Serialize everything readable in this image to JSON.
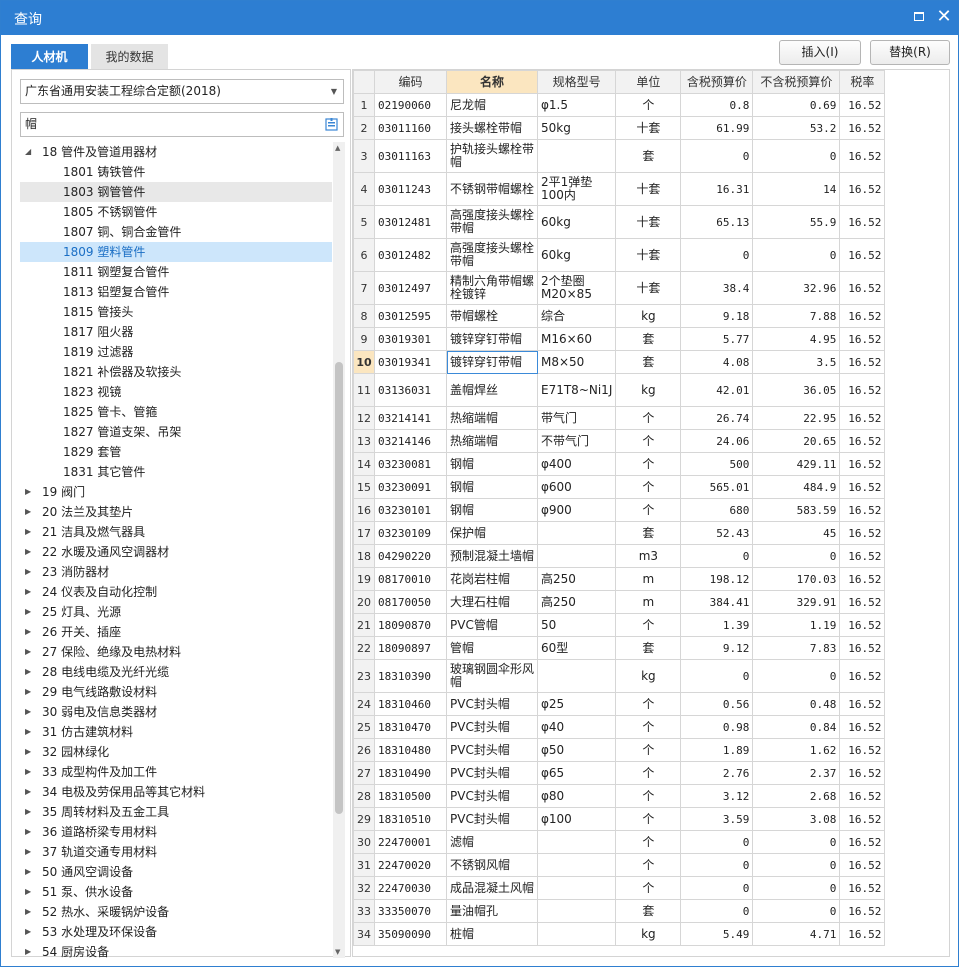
{
  "window": {
    "title": "查询"
  },
  "tabs": [
    {
      "label": "人材机"
    },
    {
      "label": "我的数据"
    }
  ],
  "toolbar": {
    "insert_label": "插入(I)",
    "replace_label": "替换(R)"
  },
  "left": {
    "quota_select": "广东省通用安装工程综合定额(2018)",
    "search_value": "帽",
    "tree": [
      {
        "label": "18 管件及管道用器材",
        "level": 0,
        "expanded": true
      },
      {
        "label": "1801 铸铁管件",
        "level": 1
      },
      {
        "label": "1803 钢管管件",
        "level": 1,
        "hover": true
      },
      {
        "label": "1805 不锈钢管件",
        "level": 1
      },
      {
        "label": "1807 铜、铜合金管件",
        "level": 1
      },
      {
        "label": "1809 塑料管件",
        "level": 1,
        "selected": true
      },
      {
        "label": "1811 钢塑复合管件",
        "level": 1
      },
      {
        "label": "1813 铝塑复合管件",
        "level": 1
      },
      {
        "label": "1815 管接头",
        "level": 1
      },
      {
        "label": "1817 阻火器",
        "level": 1
      },
      {
        "label": "1819 过滤器",
        "level": 1
      },
      {
        "label": "1821 补偿器及软接头",
        "level": 1
      },
      {
        "label": "1823 视镜",
        "level": 1
      },
      {
        "label": "1825 管卡、管箍",
        "level": 1
      },
      {
        "label": "1827 管道支架、吊架",
        "level": 1
      },
      {
        "label": "1829 套管",
        "level": 1
      },
      {
        "label": "1831 其它管件",
        "level": 1
      },
      {
        "label": "19 阀门",
        "level": 0
      },
      {
        "label": "20 法兰及其垫片",
        "level": 0
      },
      {
        "label": "21 洁具及燃气器具",
        "level": 0
      },
      {
        "label": "22 水暖及通风空调器材",
        "level": 0
      },
      {
        "label": "23 消防器材",
        "level": 0
      },
      {
        "label": "24 仪表及自动化控制",
        "level": 0
      },
      {
        "label": "25 灯具、光源",
        "level": 0
      },
      {
        "label": "26 开关、插座",
        "level": 0
      },
      {
        "label": "27 保险、绝缘及电热材料",
        "level": 0
      },
      {
        "label": "28 电线电缆及光纤光缆",
        "level": 0
      },
      {
        "label": "29 电气线路敷设材料",
        "level": 0
      },
      {
        "label": "30 弱电及信息类器材",
        "level": 0
      },
      {
        "label": "31 仿古建筑材料",
        "level": 0
      },
      {
        "label": "32 园林绿化",
        "level": 0
      },
      {
        "label": "33 成型构件及加工件",
        "level": 0
      },
      {
        "label": "34 电极及劳保用品等其它材料",
        "level": 0
      },
      {
        "label": "35 周转材料及五金工具",
        "level": 0
      },
      {
        "label": "36 道路桥梁专用材料",
        "level": 0
      },
      {
        "label": "37 轨道交通专用材料",
        "level": 0
      },
      {
        "label": "50 通风空调设备",
        "level": 0
      },
      {
        "label": "51 泵、供水设备",
        "level": 0
      },
      {
        "label": "52 热水、采暖锅炉设备",
        "level": 0
      },
      {
        "label": "53 水处理及环保设备",
        "level": 0
      },
      {
        "label": "54 厨房设备",
        "level": 0
      }
    ]
  },
  "grid": {
    "columns": [
      "编码",
      "名称",
      "规格型号",
      "单位",
      "含税预算价",
      "不含税预算价",
      "税率"
    ],
    "current_row": 10,
    "rows": [
      {
        "n": "1",
        "code": "02190060",
        "name": "尼龙帽",
        "spec": "φ1.5",
        "unit": "个",
        "tax_price": "0.8",
        "notax_price": "0.69",
        "rate": "16.52"
      },
      {
        "n": "2",
        "code": "03011160",
        "name": "接头螺栓带帽",
        "spec": "50kg",
        "unit": "十套",
        "tax_price": "61.99",
        "notax_price": "53.2",
        "rate": "16.52"
      },
      {
        "n": "3",
        "code": "03011163",
        "name": "护轨接头螺栓带帽",
        "spec": "",
        "unit": "套",
        "tax_price": "0",
        "notax_price": "0",
        "rate": "16.52",
        "tall": true
      },
      {
        "n": "4",
        "code": "03011243",
        "name": "不锈钢带帽螺栓",
        "spec": "2平1弹垫 100内",
        "unit": "十套",
        "tax_price": "16.31",
        "notax_price": "14",
        "rate": "16.52",
        "tall": true
      },
      {
        "n": "5",
        "code": "03012481",
        "name": "高强度接头螺栓带帽",
        "spec": "60kg",
        "unit": "十套",
        "tax_price": "65.13",
        "notax_price": "55.9",
        "rate": "16.52",
        "tall": true
      },
      {
        "n": "6",
        "code": "03012482",
        "name": "高强度接头螺栓带帽",
        "spec": "60kg",
        "unit": "十套",
        "tax_price": "0",
        "notax_price": "0",
        "rate": "16.52",
        "tall": true
      },
      {
        "n": "7",
        "code": "03012497",
        "name": "精制六角带帽螺栓镀锌",
        "spec": "2个垫圈 M20×85",
        "unit": "十套",
        "tax_price": "38.4",
        "notax_price": "32.96",
        "rate": "16.52",
        "tall": true
      },
      {
        "n": "8",
        "code": "03012595",
        "name": "带帽螺栓",
        "spec": "综合",
        "unit": "kg",
        "tax_price": "9.18",
        "notax_price": "7.88",
        "rate": "16.52"
      },
      {
        "n": "9",
        "code": "03019301",
        "name": "镀锌穿钉带帽",
        "spec": "M16×60",
        "unit": "套",
        "tax_price": "5.77",
        "notax_price": "4.95",
        "rate": "16.52"
      },
      {
        "n": "10",
        "code": "03019341",
        "name": "镀锌穿钉带帽",
        "spec": "M8×50",
        "unit": "套",
        "tax_price": "4.08",
        "notax_price": "3.5",
        "rate": "16.52"
      },
      {
        "n": "11",
        "code": "03136031",
        "name": "盖帽焊丝",
        "spec": "E71T8~Ni1J",
        "unit": "kg",
        "tax_price": "42.01",
        "notax_price": "36.05",
        "rate": "16.52",
        "tall": true
      },
      {
        "n": "12",
        "code": "03214141",
        "name": "热缩端帽",
        "spec": "带气门",
        "unit": "个",
        "tax_price": "26.74",
        "notax_price": "22.95",
        "rate": "16.52"
      },
      {
        "n": "13",
        "code": "03214146",
        "name": "热缩端帽",
        "spec": "不带气门",
        "unit": "个",
        "tax_price": "24.06",
        "notax_price": "20.65",
        "rate": "16.52"
      },
      {
        "n": "14",
        "code": "03230081",
        "name": "钢帽",
        "spec": "φ400",
        "unit": "个",
        "tax_price": "500",
        "notax_price": "429.11",
        "rate": "16.52"
      },
      {
        "n": "15",
        "code": "03230091",
        "name": "钢帽",
        "spec": "φ600",
        "unit": "个",
        "tax_price": "565.01",
        "notax_price": "484.9",
        "rate": "16.52"
      },
      {
        "n": "16",
        "code": "03230101",
        "name": "钢帽",
        "spec": "φ900",
        "unit": "个",
        "tax_price": "680",
        "notax_price": "583.59",
        "rate": "16.52"
      },
      {
        "n": "17",
        "code": "03230109",
        "name": "保护帽",
        "spec": "",
        "unit": "套",
        "tax_price": "52.43",
        "notax_price": "45",
        "rate": "16.52"
      },
      {
        "n": "18",
        "code": "04290220",
        "name": "预制混凝土墙帽",
        "spec": "",
        "unit": "m3",
        "tax_price": "0",
        "notax_price": "0",
        "rate": "16.52"
      },
      {
        "n": "19",
        "code": "08170010",
        "name": "花岗岩柱帽",
        "spec": "高250",
        "unit": "m",
        "tax_price": "198.12",
        "notax_price": "170.03",
        "rate": "16.52"
      },
      {
        "n": "20",
        "code": "08170050",
        "name": "大理石柱帽",
        "spec": "高250",
        "unit": "m",
        "tax_price": "384.41",
        "notax_price": "329.91",
        "rate": "16.52"
      },
      {
        "n": "21",
        "code": "18090870",
        "name": "PVC管帽",
        "spec": "50",
        "unit": "个",
        "tax_price": "1.39",
        "notax_price": "1.19",
        "rate": "16.52"
      },
      {
        "n": "22",
        "code": "18090897",
        "name": "管帽",
        "spec": "60型",
        "unit": "套",
        "tax_price": "9.12",
        "notax_price": "7.83",
        "rate": "16.52"
      },
      {
        "n": "23",
        "code": "18310390",
        "name": "玻璃钢圆伞形风帽",
        "spec": "",
        "unit": "kg",
        "tax_price": "0",
        "notax_price": "0",
        "rate": "16.52",
        "tall": true
      },
      {
        "n": "24",
        "code": "18310460",
        "name": "PVC封头帽",
        "spec": "φ25",
        "unit": "个",
        "tax_price": "0.56",
        "notax_price": "0.48",
        "rate": "16.52"
      },
      {
        "n": "25",
        "code": "18310470",
        "name": "PVC封头帽",
        "spec": "φ40",
        "unit": "个",
        "tax_price": "0.98",
        "notax_price": "0.84",
        "rate": "16.52"
      },
      {
        "n": "26",
        "code": "18310480",
        "name": "PVC封头帽",
        "spec": "φ50",
        "unit": "个",
        "tax_price": "1.89",
        "notax_price": "1.62",
        "rate": "16.52"
      },
      {
        "n": "27",
        "code": "18310490",
        "name": "PVC封头帽",
        "spec": "φ65",
        "unit": "个",
        "tax_price": "2.76",
        "notax_price": "2.37",
        "rate": "16.52"
      },
      {
        "n": "28",
        "code": "18310500",
        "name": "PVC封头帽",
        "spec": "φ80",
        "unit": "个",
        "tax_price": "3.12",
        "notax_price": "2.68",
        "rate": "16.52"
      },
      {
        "n": "29",
        "code": "18310510",
        "name": "PVC封头帽",
        "spec": "φ100",
        "unit": "个",
        "tax_price": "3.59",
        "notax_price": "3.08",
        "rate": "16.52"
      },
      {
        "n": "30",
        "code": "22470001",
        "name": "滤帽",
        "spec": "",
        "unit": "个",
        "tax_price": "0",
        "notax_price": "0",
        "rate": "16.52"
      },
      {
        "n": "31",
        "code": "22470020",
        "name": "不锈钢风帽",
        "spec": "",
        "unit": "个",
        "tax_price": "0",
        "notax_price": "0",
        "rate": "16.52"
      },
      {
        "n": "32",
        "code": "22470030",
        "name": "成品混凝土风帽",
        "spec": "",
        "unit": "个",
        "tax_price": "0",
        "notax_price": "0",
        "rate": "16.52"
      },
      {
        "n": "33",
        "code": "33350070",
        "name": "量油帽孔",
        "spec": "",
        "unit": "套",
        "tax_price": "0",
        "notax_price": "0",
        "rate": "16.52"
      },
      {
        "n": "34",
        "code": "35090090",
        "name": "桩帽",
        "spec": "",
        "unit": "kg",
        "tax_price": "5.49",
        "notax_price": "4.71",
        "rate": "16.52"
      }
    ]
  }
}
